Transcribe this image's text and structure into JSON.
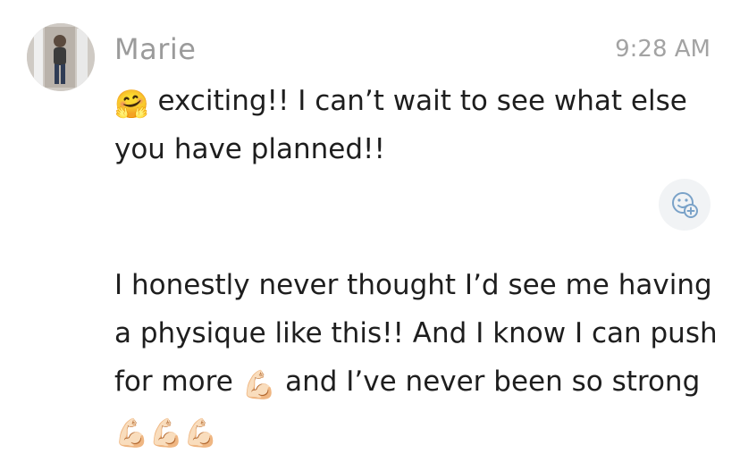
{
  "message": {
    "sender": "Marie",
    "time": "9:28 AM",
    "avatar_icon": "user-photo-avatar",
    "first": {
      "emoji": "🤗",
      "text": " exciting!! I can’t wait to see what else you have planned!!"
    },
    "second": {
      "text_a": "I honestly never thought I’d see me having a physique like this!! And I know I can push for more ",
      "emoji_a": "💪🏻",
      "text_b": " and I’ve never been so strong ",
      "emoji_b": "💪🏻💪🏻💪🏻"
    },
    "reaction_icon": "add-reaction-icon"
  },
  "colors": {
    "sender": "#9b9b9b",
    "timestamp": "#a3a3a3",
    "text": "#1e1e1e",
    "reaction_bg": "#f1f3f5",
    "reaction_icon": "#7aa2c8"
  }
}
